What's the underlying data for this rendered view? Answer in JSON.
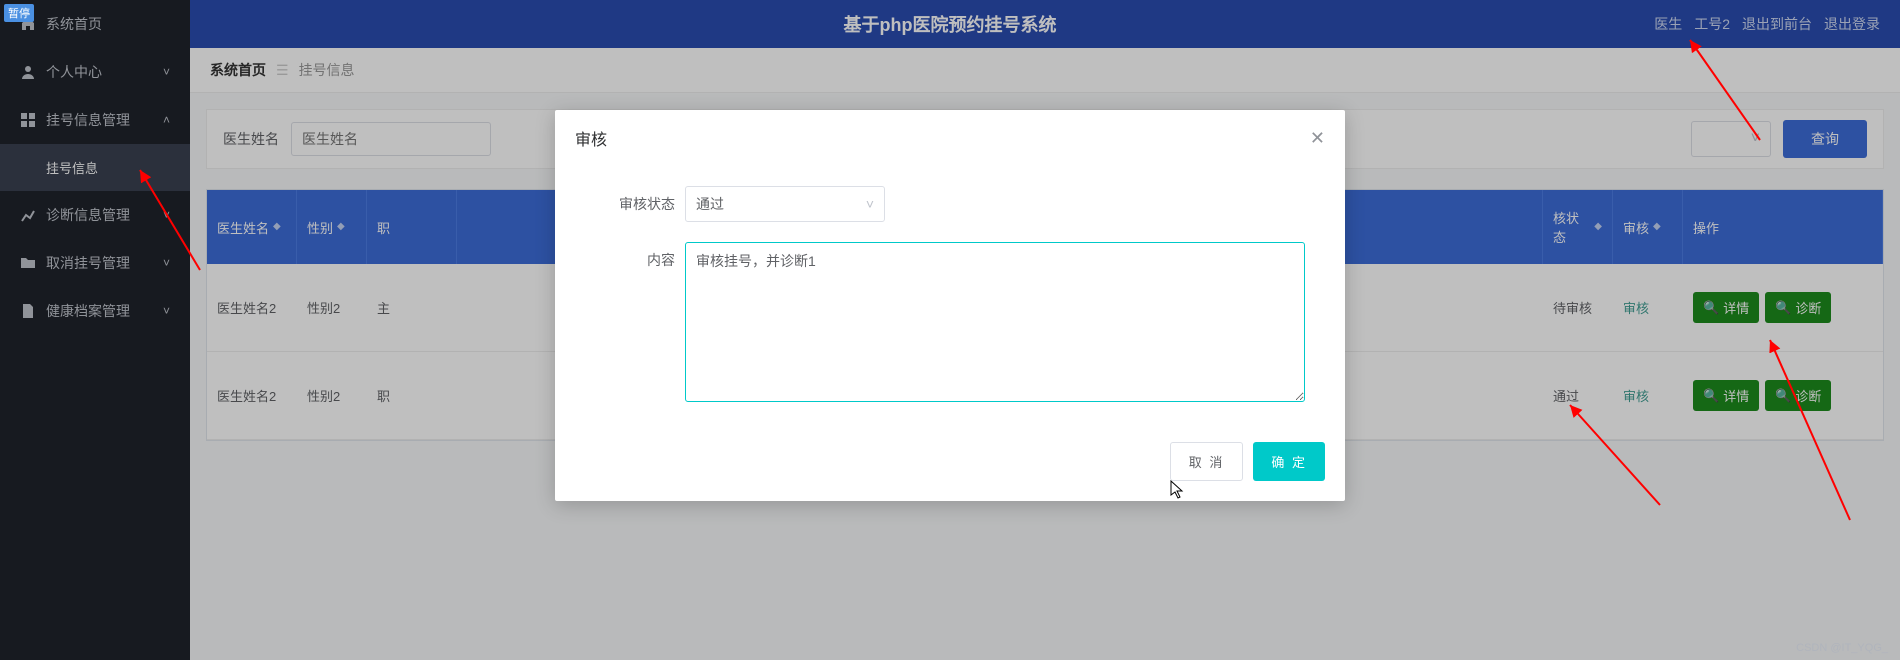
{
  "badge": {
    "pause": "暂停"
  },
  "sidebar": {
    "items": [
      {
        "label": "系统首页",
        "icon": "home"
      },
      {
        "label": "个人中心",
        "icon": "user",
        "chev": "˅"
      },
      {
        "label": "挂号信息管理",
        "icon": "grid",
        "chev": "˄"
      },
      {
        "label": "诊断信息管理",
        "icon": "chart",
        "chev": "˅"
      },
      {
        "label": "取消挂号管理",
        "icon": "folder",
        "chev": "˅"
      },
      {
        "label": "健康档案管理",
        "icon": "file",
        "chev": "˅"
      }
    ],
    "sub": {
      "label": "挂号信息"
    }
  },
  "header": {
    "title": "基于php医院预约挂号系统",
    "right": {
      "role": "医生",
      "uid": "工号2",
      "front": "退出到前台",
      "logout": "退出登录"
    }
  },
  "crumb": {
    "a": "系统首页",
    "b": "挂号信息"
  },
  "search": {
    "label": "医生姓名",
    "placeholder": "医生姓名",
    "btn": "查询"
  },
  "table": {
    "headers": {
      "name": "医生姓名",
      "sex": "性别",
      "dept": "职",
      "status": "核状态",
      "audit": "审核",
      "ops": "操作"
    },
    "rows": [
      {
        "name": "医生姓名2",
        "sex": "性别2",
        "dept": "主",
        "status": "待审核",
        "audit": "审核"
      },
      {
        "name": "医生姓名2",
        "sex": "性别2",
        "dept": "职",
        "status": "通过",
        "audit": "审核"
      }
    ],
    "btns": {
      "detail": "详情",
      "diag": "诊断"
    }
  },
  "modal": {
    "title": "审核",
    "status_label": "审核状态",
    "status_value": "通过",
    "content_label": "内容",
    "content_value": "审核挂号，并诊断1",
    "cancel": "取 消",
    "ok": "确 定"
  },
  "watermark": "CSDN @IT_YQG_"
}
